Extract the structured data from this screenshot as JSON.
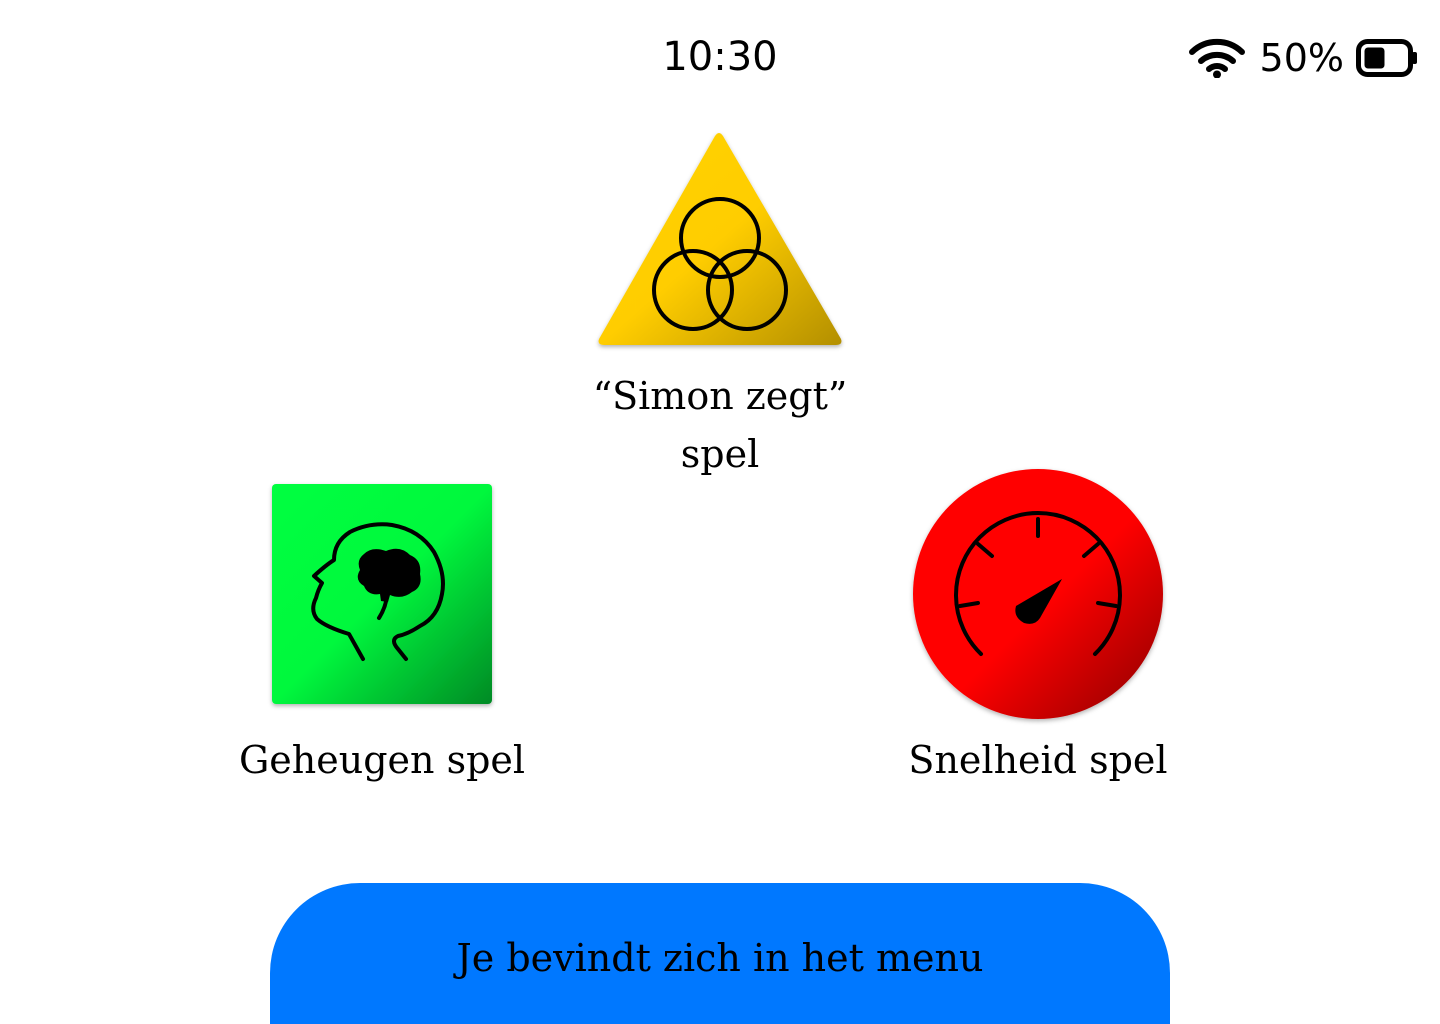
{
  "status_bar": {
    "time": "10:30",
    "battery_percent": "50%",
    "battery_level": 0.5,
    "icons": [
      "wifi-icon",
      "battery-icon"
    ]
  },
  "games": {
    "simon": {
      "label": "“Simon zegt”\nspel",
      "icon": "overlapping-circles-icon",
      "color": "#ffd000",
      "shape": "triangle"
    },
    "memory": {
      "label": "Geheugen spel",
      "icon": "head-brain-icon",
      "color": "#00ff40",
      "shape": "square"
    },
    "speed": {
      "label": "Snelheid spel",
      "icon": "speedometer-icon",
      "color": "#ff0000",
      "shape": "circle"
    }
  },
  "menu_status": {
    "text": "Je bevindt zich in het menu",
    "color": "#0078ff"
  }
}
